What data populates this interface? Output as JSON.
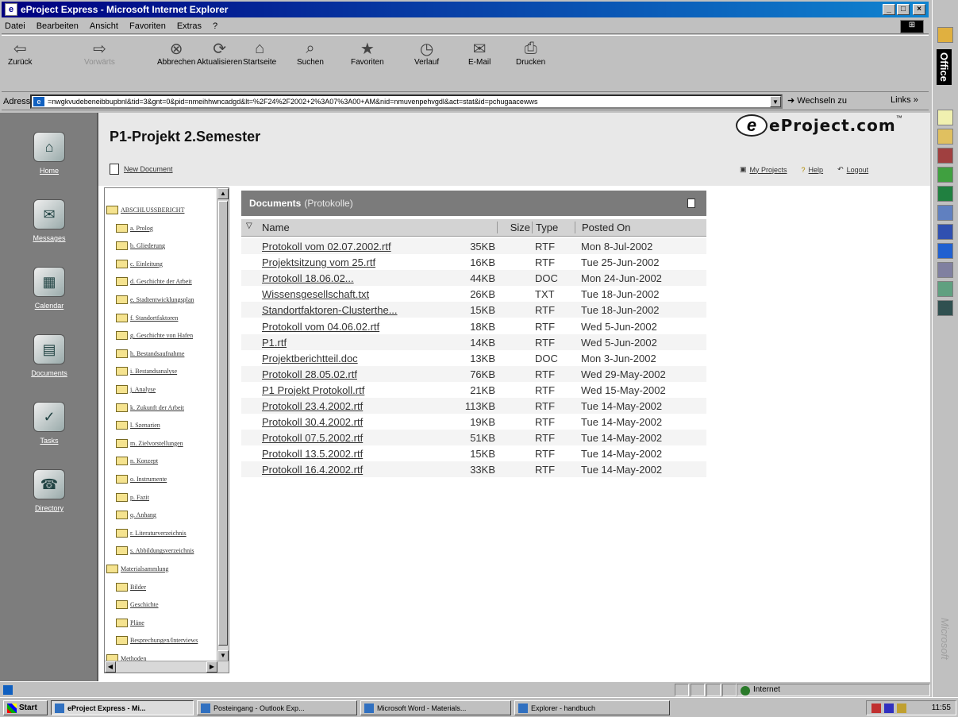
{
  "window": {
    "title": "eProject Express - Microsoft Internet Explorer"
  },
  "menu": [
    "Datei",
    "Bearbeiten",
    "Ansicht",
    "Favoriten",
    "Extras",
    "?"
  ],
  "toolbar": [
    {
      "label": "Zurück",
      "icon": "back-icon",
      "enabled": true
    },
    {
      "label": "Vorwärts",
      "icon": "forward-icon",
      "enabled": false
    },
    {
      "label": "Abbrechen",
      "icon": "stop-icon",
      "enabled": true
    },
    {
      "label": "Aktualisieren",
      "icon": "refresh-icon",
      "enabled": true
    },
    {
      "label": "Startseite",
      "icon": "home-icon",
      "enabled": true
    },
    {
      "label": "Suchen",
      "icon": "search-icon",
      "enabled": true
    },
    {
      "label": "Favoriten",
      "icon": "favorites-icon",
      "enabled": true
    },
    {
      "label": "Verlauf",
      "icon": "history-icon",
      "enabled": true
    },
    {
      "label": "E-Mail",
      "icon": "mail-icon",
      "enabled": true
    },
    {
      "label": "Drucken",
      "icon": "print-icon",
      "enabled": true
    }
  ],
  "address": {
    "label": "Adresse",
    "value": "=nwgkvudebeneibbupbnl&tid=3&gnt=0&pid=nmeihhwncadgd&lt=%2F24%2F2002+2%3A07%3A00+AM&nid=nmuvenpehvgdl&act=stat&id=pchugaacewws",
    "go": "Wechseln zu",
    "links": "Links »"
  },
  "leftnav": [
    {
      "label": "Home",
      "icon": "home-icon"
    },
    {
      "label": "Messages",
      "icon": "messages-icon"
    },
    {
      "label": "Calendar",
      "icon": "calendar-icon"
    },
    {
      "label": "Documents",
      "icon": "documents-icon"
    },
    {
      "label": "Tasks",
      "icon": "tasks-icon"
    },
    {
      "label": "Directory",
      "icon": "directory-icon"
    }
  ],
  "header": {
    "title": "P1-Projekt 2.Semester",
    "new_document": "New Document",
    "logo_text": "eProject.com",
    "logo_e": "e",
    "tm": "™",
    "links": [
      "My Projects",
      "Help",
      "Logout"
    ]
  },
  "tree": [
    {
      "label": "ABSCHLUSSBERICHT",
      "level": 0
    },
    {
      "label": "a. Prolog",
      "level": 1
    },
    {
      "label": "b. Gliederung",
      "level": 1
    },
    {
      "label": "c. Einleitung",
      "level": 1
    },
    {
      "label": "d. Geschichte der Arbeit",
      "level": 1
    },
    {
      "label": "e. Stadtentwicklungsplan",
      "level": 1
    },
    {
      "label": "f. Standortfaktoren",
      "level": 1
    },
    {
      "label": "g. Geschichte von Hafen",
      "level": 1
    },
    {
      "label": "h. Bestandsaufnahme",
      "level": 1
    },
    {
      "label": "i. Bestandsanalyse",
      "level": 1
    },
    {
      "label": "j. Analyse",
      "level": 1
    },
    {
      "label": "k. Zukunft der Arbeit",
      "level": 1
    },
    {
      "label": "l. Szenarien",
      "level": 1
    },
    {
      "label": "m. Zielvorstellungen",
      "level": 1
    },
    {
      "label": "n. Konzept",
      "level": 1
    },
    {
      "label": "o. Instrumente",
      "level": 1
    },
    {
      "label": "p. Fazit",
      "level": 1
    },
    {
      "label": "q. Anhang",
      "level": 1
    },
    {
      "label": "r. Literaturverzeichnis",
      "level": 1
    },
    {
      "label": "s. Abbildungsverzeichnis",
      "level": 1
    },
    {
      "label": "Materialsammlung",
      "level": 0
    },
    {
      "label": "Bilder",
      "level": 1
    },
    {
      "label": "Geschichte",
      "level": 1
    },
    {
      "label": "Pläne",
      "level": 1
    },
    {
      "label": "Besprechungen/Interviews",
      "level": 1
    },
    {
      "label": "Methoden",
      "level": 0
    }
  ],
  "documents": {
    "title": "Documents",
    "folder": "(Protokolle)",
    "columns": {
      "name": "Name",
      "size": "Size",
      "type": "Type",
      "posted": "Posted On"
    },
    "rows": [
      {
        "name": "Protokoll vom 02.07.2002.rtf",
        "size": "35KB",
        "type": "RTF",
        "posted": "Mon 8-Jul-2002"
      },
      {
        "name": "Projektsitzung vom 25.rtf",
        "size": "16KB",
        "type": "RTF",
        "posted": "Tue 25-Jun-2002"
      },
      {
        "name": "Protokoll 18.06.02...",
        "size": "44KB",
        "type": "DOC",
        "posted": "Mon 24-Jun-2002"
      },
      {
        "name": "Wissensgesellschaft.txt",
        "size": "26KB",
        "type": "TXT",
        "posted": "Tue 18-Jun-2002"
      },
      {
        "name": "Standortfaktoren-Clusterthe...",
        "size": "15KB",
        "type": "RTF",
        "posted": "Tue 18-Jun-2002"
      },
      {
        "name": "Protokoll vom 04.06.02.rtf",
        "size": "18KB",
        "type": "RTF",
        "posted": "Wed 5-Jun-2002"
      },
      {
        "name": "P1.rtf",
        "size": "14KB",
        "type": "RTF",
        "posted": "Wed 5-Jun-2002"
      },
      {
        "name": "Projektberichtteil.doc",
        "size": "13KB",
        "type": "DOC",
        "posted": "Mon 3-Jun-2002"
      },
      {
        "name": "Protokoll 28.05.02.rtf",
        "size": "76KB",
        "type": "RTF",
        "posted": "Wed 29-May-2002"
      },
      {
        "name": "P1 Projekt Protokoll.rtf",
        "size": "21KB",
        "type": "RTF",
        "posted": "Wed 15-May-2002"
      },
      {
        "name": "Protokoll 23.4.2002.rtf",
        "size": "113KB",
        "type": "RTF",
        "posted": "Tue 14-May-2002"
      },
      {
        "name": "Protokoll 30.4.2002.rtf",
        "size": "19KB",
        "type": "RTF",
        "posted": "Tue 14-May-2002"
      },
      {
        "name": "Protokoll 07.5.2002.rtf",
        "size": "51KB",
        "type": "RTF",
        "posted": "Tue 14-May-2002"
      },
      {
        "name": "Protokoll 13.5.2002.rtf",
        "size": "15KB",
        "type": "RTF",
        "posted": "Tue 14-May-2002"
      },
      {
        "name": "Protokoll 16.4.2002.rtf",
        "size": "33KB",
        "type": "RTF",
        "posted": "Tue 14-May-2002"
      }
    ]
  },
  "status": {
    "zone": "Internet"
  },
  "taskbar": {
    "start": "Start",
    "tasks": [
      {
        "label": "eProject Express - Mi...",
        "active": true
      },
      {
        "label": "Posteingang - Outlook Exp...",
        "active": false
      },
      {
        "label": "Microsoft Word - Materials...",
        "active": false
      },
      {
        "label": "Explorer - handbuch",
        "active": false
      }
    ],
    "clock": "11:55"
  },
  "office_bar": {
    "title": "Office",
    "brand": "Microsoft"
  }
}
